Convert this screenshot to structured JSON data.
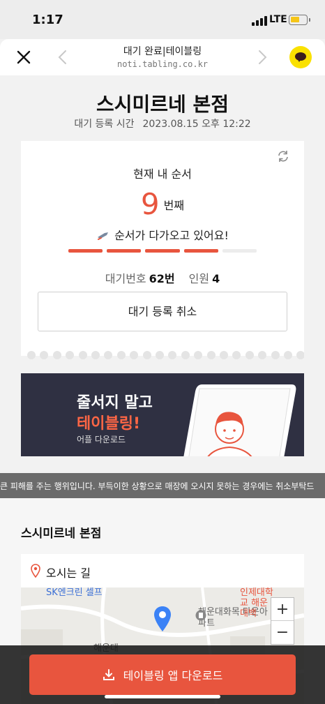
{
  "status_bar": {
    "time": "1:17",
    "network": "LTE"
  },
  "webview": {
    "title": "대기 완료|테이블링",
    "url": "noti.tabling.co.kr",
    "close_icon": "close-icon",
    "prev_icon": "chevron-left-icon",
    "next_icon": "chevron-right-icon",
    "share_icon": "kakaotalk-icon"
  },
  "store": {
    "name": "스시미르네 본점",
    "registered_label": "대기 등록 시간",
    "registered_time": "2023.08.15 오후 12:22"
  },
  "queue_card": {
    "order_label": "현재 내 순서",
    "order_number": "9",
    "order_unit": "번째",
    "message": "순서가 다가오고 있어요!",
    "progress_segments_total": 5,
    "progress_segments_filled": 4,
    "wait_number_label": "대기번호",
    "wait_number_value": "62번",
    "party_label": "인원",
    "party_value": "4",
    "cancel_button": "대기 등록 취소"
  },
  "promo_banner": {
    "line1": "줄서지 말고",
    "line2": "테이블링!",
    "line3": "어플 다운로드"
  },
  "notice_ticker": "큰 피해를 주는 행위입니다. 부득이한 상황으로 매장에 오시지 못하는 경우에는 취소부탁드",
  "location_section": {
    "store_name": "스시미르네 본점",
    "directions_label": "오시는 길",
    "map": {
      "labels": [
        "SK엔크린 셀프",
        "해운대화목 타운아파트",
        "인제대학교 해운대백",
        "해운대"
      ],
      "zoom_in": "+",
      "zoom_out": "−"
    }
  },
  "download_button": "테이블링 앱 다운로드",
  "colors": {
    "accent": "#e8553e",
    "banner_bg": "#2f3042",
    "kakao": "#fae100"
  }
}
